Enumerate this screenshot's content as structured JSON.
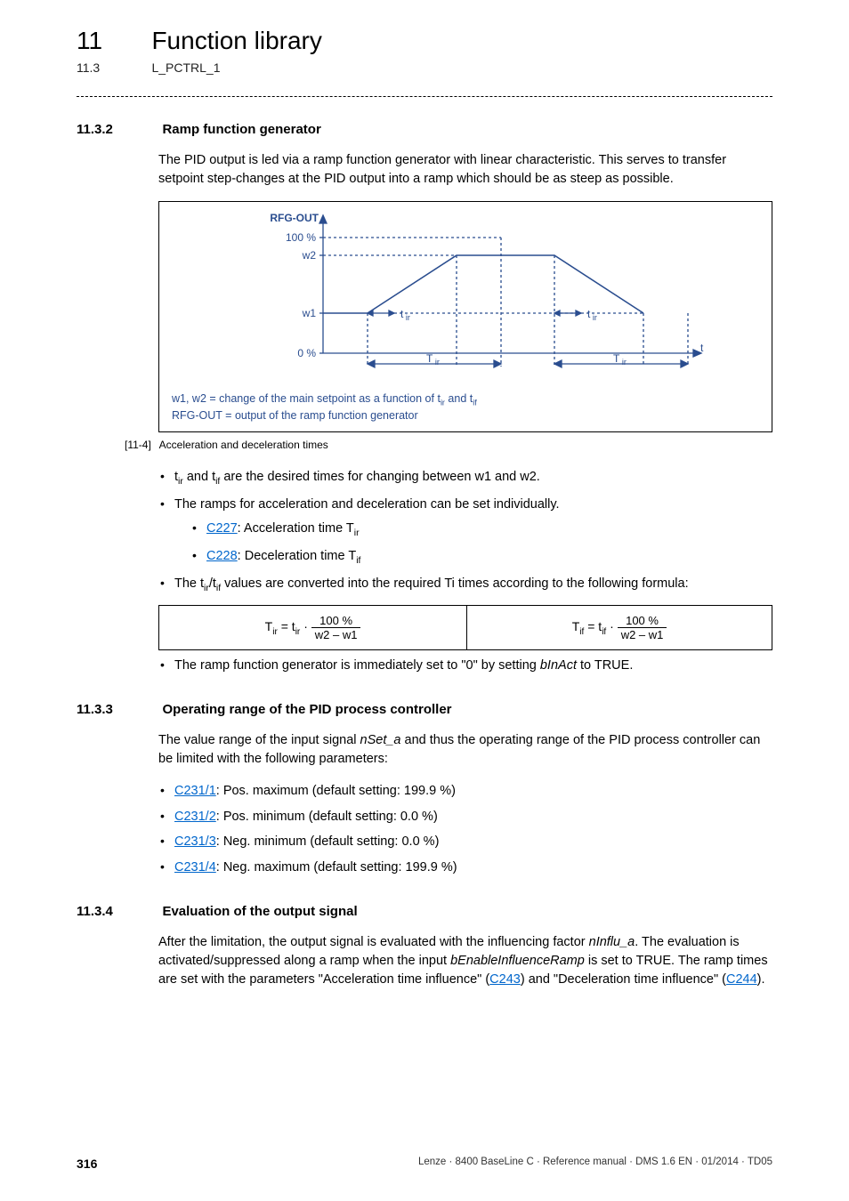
{
  "header": {
    "chapter_num": "11",
    "chapter_title": "Function library",
    "section_num": "11.3",
    "section_title": "L_PCTRL_1"
  },
  "sec_11_3_2": {
    "num": "11.3.2",
    "title": "Ramp function generator",
    "intro": "The PID output is led via a ramp function generator with linear characteristic. This serves to transfer setpoint step-changes at the PID output into a ramp which should be as steep as possible.",
    "fig": {
      "label_rfg": "RFG-OUT",
      "y100": "100 %",
      "yw2": "w2",
      "yw1": "w1",
      "y0": "0 %",
      "tir": "t",
      "Tir": "T",
      "t_axis": "t",
      "legend_line1_pre": "w1, w2 = change of the main setpoint as a function of t",
      "legend_line1_mid": " and t",
      "legend_line2": "RFG-OUT = output of the ramp function generator"
    },
    "fig_caption_tag": "[11-4]",
    "fig_caption": "Acceleration and deceleration times",
    "bullets": {
      "b1_pre": "t",
      "b1_mid": " and t",
      "b1_post": " are the desired times for changing between w1 and w2.",
      "b2": "The ramps for acceleration and deceleration can be set individually.",
      "b2a_link": "C227",
      "b2a_post": ": Acceleration time T",
      "b2b_link": "C228",
      "b2b_post": ": Deceleration time T",
      "b3_pre": "The t",
      "b3_mid": "/t",
      "b3_post": " values are converted into the required Ti times according to the following formula:",
      "b4_pre": "The ramp function generator is immediately set to \"0\" by setting ",
      "b4_var": "bInAct",
      "b4_post": " to TRUE."
    },
    "formula": {
      "left_lhs": "T",
      "eq": " = ",
      "t_sym": "t",
      "dot": " · ",
      "num": "100 %",
      "den": "w2 – w1"
    }
  },
  "sec_11_3_3": {
    "num": "11.3.3",
    "title": "Operating range of the PID process controller",
    "intro_pre": "The value range of the input signal ",
    "intro_var": "nSet_a",
    "intro_post": " and thus the operating range of the PID process controller can be limited with the following parameters:",
    "items": {
      "i1_link": "C231/1",
      "i1_post": ": Pos. maximum (default setting: 199.9 %)",
      "i2_link": "C231/2",
      "i2_post": ": Pos. minimum (default setting: 0.0 %)",
      "i3_link": "C231/3",
      "i3_post": ": Neg. minimum (default setting: 0.0 %)",
      "i4_link": "C231/4",
      "i4_post": ": Neg. maximum (default setting: 199.9 %)"
    }
  },
  "sec_11_3_4": {
    "num": "11.3.4",
    "title": "Evaluation of the output signal",
    "p_pre": "After the limitation, the output signal is evaluated with the influencing factor ",
    "p_var1": "nInflu_a",
    "p_mid1": ". The evaluation is activated/suppressed along a ramp when the input ",
    "p_var2": "bEnableInfluenceRamp",
    "p_mid2": " is set to TRUE. The ramp times are set with the parameters \"Acceleration time influence\" (",
    "p_link1": "C243",
    "p_mid3": ") and \"Deceleration time influence\" (",
    "p_link2": "C244",
    "p_end": ")."
  },
  "footer": {
    "page": "316",
    "right": "Lenze · 8400 BaseLine C · Reference manual · DMS 1.6 EN · 01/2014 · TD05"
  }
}
